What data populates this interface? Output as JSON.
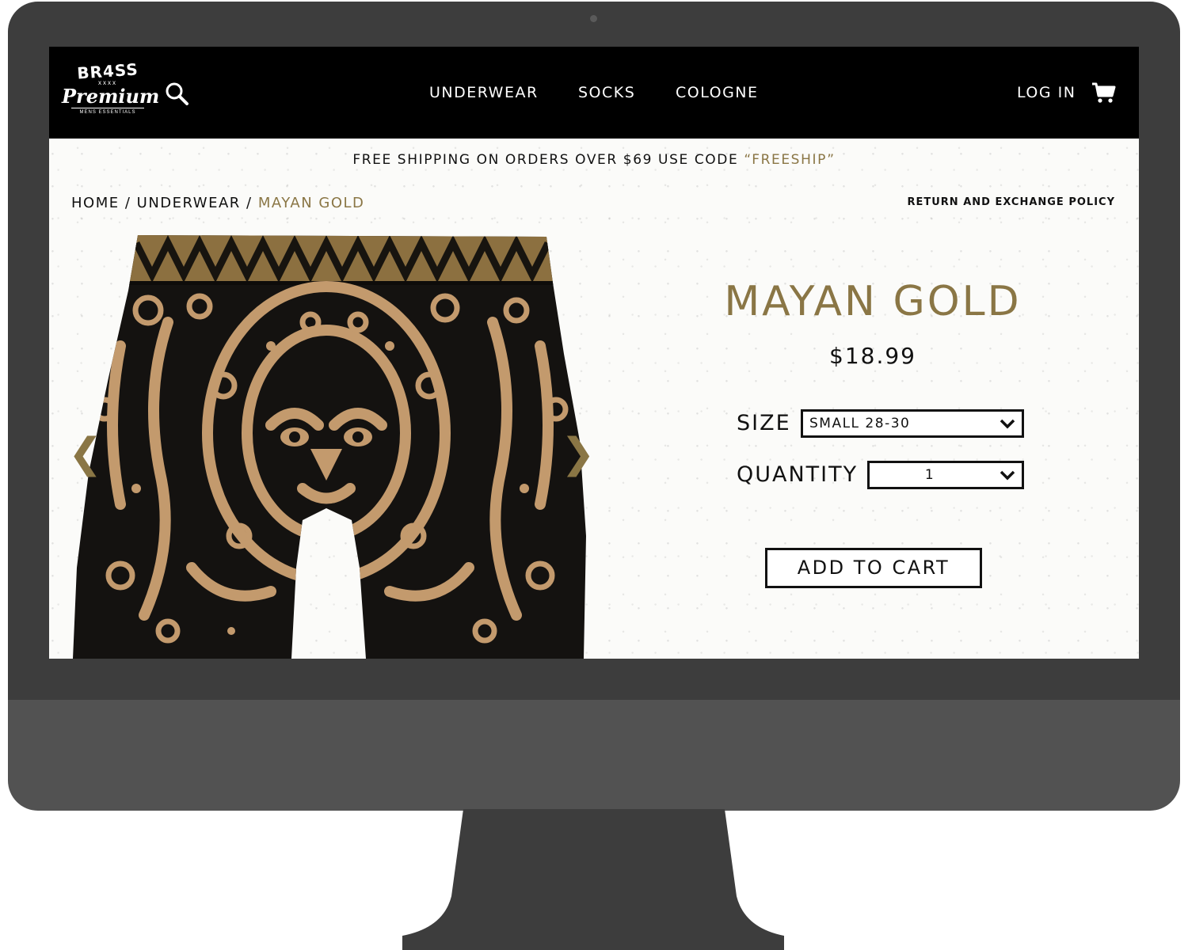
{
  "colors": {
    "accent": "#8a7645",
    "header_bg": "#000000",
    "monitor_frame": "#3d3d3d",
    "monitor_chin": "#525252"
  },
  "logo": {
    "top": "BR4SS",
    "marks": "xxxx",
    "script": "Premium",
    "tagline": "MENS ESSENTIALS"
  },
  "header": {
    "search_icon": "search-icon",
    "nav": [
      "UNDERWEAR",
      "SOCKS",
      "COLOGNE"
    ],
    "login": "LOG IN",
    "cart_icon": "cart-icon"
  },
  "promo": {
    "text": "FREE SHIPPING ON ORDERS OVER $69 USE CODE ",
    "code": "“FREESHIP”"
  },
  "breadcrumb": {
    "home": "HOME",
    "sep": "/",
    "category": "UNDERWEAR",
    "current": "MAYAN GOLD"
  },
  "policy_link": "RETURN AND EXCHANGE POLICY",
  "gallery": {
    "prev": "❮",
    "next": "❯",
    "image": "boxer-briefs-mayan-pattern"
  },
  "product": {
    "title": "MAYAN GOLD",
    "price": "$18.99",
    "size_label": "SIZE",
    "size_value": "SMALL 28-30",
    "quantity_label": "QUANTITY",
    "quantity_value": "1",
    "add_to_cart": "ADD TO CART"
  }
}
